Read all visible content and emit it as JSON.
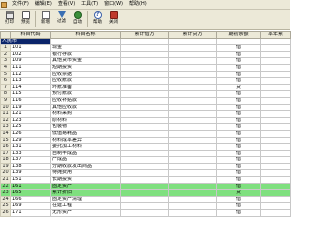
{
  "menu": [
    "文件(F)",
    "编辑(E)",
    "查看(V)",
    "工具(T)",
    "窗口(W)",
    "帮助(H)"
  ],
  "toolbar": [
    {
      "label": "打印",
      "icon": "print-icon"
    },
    {
      "label": "预览",
      "icon": "preview-icon"
    },
    {
      "label": "新增",
      "icon": "add-icon"
    },
    {
      "label": "过滤",
      "icon": "filter-icon"
    },
    {
      "label": "自动",
      "icon": "auto-icon"
    },
    {
      "label": "帮助",
      "icon": "help-icon"
    },
    {
      "label": "关闭",
      "icon": "close-icon"
    }
  ],
  "columns": [
    "",
    "科目代码",
    "科目名称",
    "累计借方",
    "累计贷方",
    "期初余额",
    "本年累"
  ],
  "filter_value": "人民币",
  "rows": [
    {
      "code": "101",
      "name": "现金",
      "bal": "借"
    },
    {
      "code": "102",
      "name": "银行存款",
      "bal": "借"
    },
    {
      "code": "109",
      "name": "其他货币资金",
      "bal": "借"
    },
    {
      "code": "111",
      "name": "短期投资",
      "bal": "借"
    },
    {
      "code": "112",
      "name": "应收票据",
      "bal": "借"
    },
    {
      "code": "113",
      "name": "应收账款",
      "bal": "借"
    },
    {
      "code": "114",
      "name": "坏账准备",
      "bal": "贷"
    },
    {
      "code": "115",
      "name": "预付账款",
      "bal": "借"
    },
    {
      "code": "116",
      "name": "应收补贴款",
      "bal": "借"
    },
    {
      "code": "119",
      "name": "其他应收款",
      "bal": "借"
    },
    {
      "code": "121",
      "name": "材料采购",
      "bal": "借"
    },
    {
      "code": "123",
      "name": "原材料",
      "bal": "借"
    },
    {
      "code": "125",
      "name": "包装物",
      "bal": "借"
    },
    {
      "code": "126",
      "name": "低值易耗品",
      "bal": "借"
    },
    {
      "code": "129",
      "name": "材料成本差异",
      "bal": "借"
    },
    {
      "code": "131",
      "name": "委托加工材料",
      "bal": "借"
    },
    {
      "code": "133",
      "name": "自制半成品",
      "bal": "借"
    },
    {
      "code": "137",
      "name": "产成品",
      "bal": "借"
    },
    {
      "code": "138",
      "name": "分期收款发出商品",
      "bal": "借"
    },
    {
      "code": "139",
      "name": "待摊费用",
      "bal": "借"
    },
    {
      "code": "151",
      "name": "长期投资",
      "bal": "借"
    },
    {
      "code": "161",
      "name": "固定资产",
      "bal": "借",
      "hl": true
    },
    {
      "code": "165",
      "name": "累计折旧",
      "bal": "贷",
      "hl": true
    },
    {
      "code": "166",
      "name": "固定资产清理",
      "bal": "借"
    },
    {
      "code": "169",
      "name": "在建工程",
      "bal": "借"
    },
    {
      "code": "171",
      "name": "无形资产",
      "bal": "借"
    }
  ]
}
